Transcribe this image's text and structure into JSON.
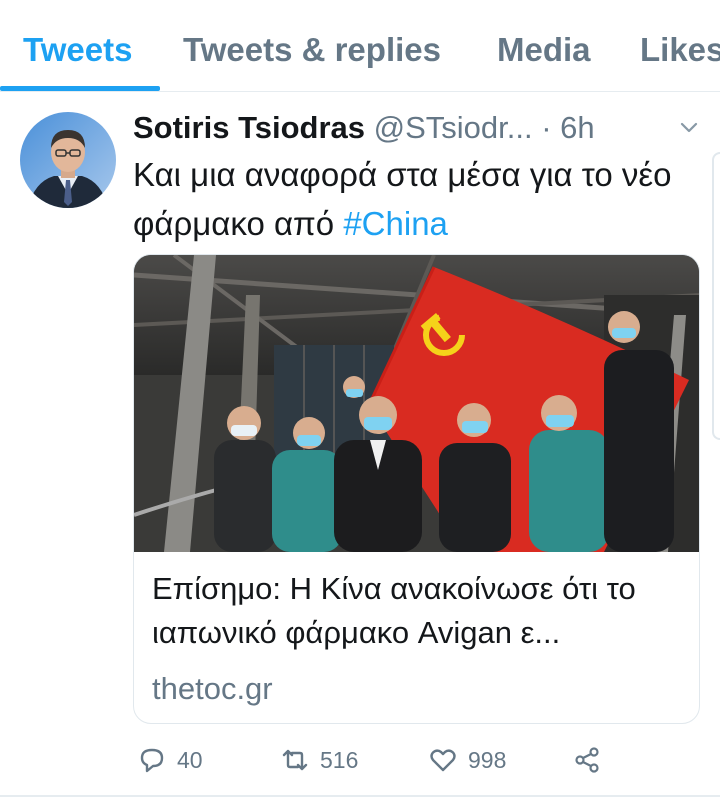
{
  "tabs": [
    {
      "label": "Tweets",
      "active": true
    },
    {
      "label": "Tweets & replies",
      "active": false
    },
    {
      "label": "Media",
      "active": false
    },
    {
      "label": "Likes",
      "active": false
    }
  ],
  "tweet": {
    "author_name": "Sotiris Tsiodras",
    "author_handle": "@STsiodr...",
    "separator": "·",
    "time": "6h",
    "text": "Και μια αναφορά στα μέσα για το νέο φάρμακο από ",
    "hashtag": "#China",
    "card": {
      "title": "Επίσημο: Η Κίνα ανακοίνωσε ότι το ιαπωνικό φάρμακο Avigan ε...",
      "domain": "thetoc.gr",
      "image_icon": "party-flag-group-photo"
    },
    "actions": {
      "replies": "40",
      "retweets": "516",
      "likes": "998"
    }
  },
  "icons": {
    "reply": "speech-bubble-icon",
    "retweet": "retweet-arrows-icon",
    "like": "heart-icon",
    "share": "share-nodes-icon",
    "more": "chevron-down-icon"
  },
  "colors": {
    "accent": "#1da1f2",
    "secondary_text": "#657786",
    "primary_text": "#14171a",
    "flag_red": "#d92b21",
    "flag_yellow": "#f5d21a"
  }
}
